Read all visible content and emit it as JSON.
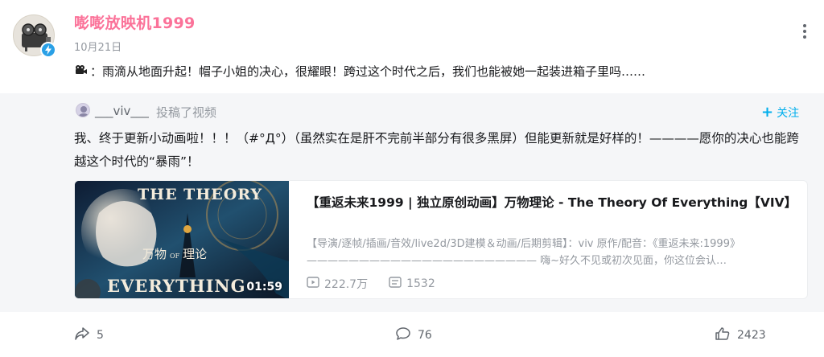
{
  "author": {
    "name": "嘭嘭放映机1999",
    "date": "10月21日",
    "avatar_icon": "film-projector-icon",
    "badge_icon": "lightning-icon",
    "name_color": "#fb7299"
  },
  "post": {
    "emoji_icon": "projector-emoji-icon",
    "text": "：雨滴从地面升起！帽子小姐的决心，很耀眼！跨过这个时代之后，我们也能被她一起装进箱子里吗……"
  },
  "repost": {
    "author": "___viv___",
    "action": "投稿了视频",
    "follow_label": "关注",
    "text": "我、终于更新小动画啦！！！（#°Д°）（虽然实在是肝不完前半部分有很多黑屏）但能更新就是好样的！————愿你的决心也能跨越这个时代的“暴雨”！",
    "video": {
      "title": "【重返未来1999 | 独立原创动画】万物理论 - The Theory Of Everything【VIV】",
      "description": "【导演/逐帧/插画/音效/live2d/3D建模＆动画/后期剪辑】：viv 原作/配音：《重返未来:1999》 —————————————————————— 嗨~好久不见或初次见面，你这位会认…",
      "duration": "01:59",
      "views": "222.7万",
      "danmaku": "1532",
      "thumb_top": "THE THEORY",
      "thumb_mid": "万物",
      "thumb_of": "OF",
      "thumb_mid2": "理论",
      "thumb_bottom": "EVERYTHING"
    }
  },
  "actions": {
    "share": "5",
    "comment": "76",
    "like": "2423"
  }
}
